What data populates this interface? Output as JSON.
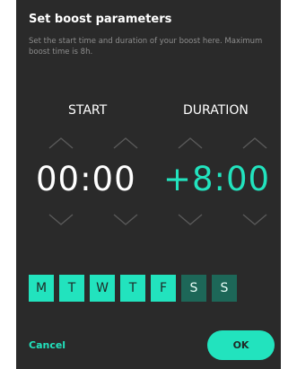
{
  "dialog": {
    "title": "Set boost parameters",
    "description": "Set the start time and duration of your boost here. Maximum boost time is 8h."
  },
  "start": {
    "label": "START",
    "value": "00:00",
    "color": "#ffffff"
  },
  "duration": {
    "label": "DURATION",
    "value": "+8:00",
    "color": "#22e3be"
  },
  "icons": {
    "up": "chevron-up-icon",
    "down": "chevron-down-icon"
  },
  "days": [
    {
      "label": "M",
      "selected": true
    },
    {
      "label": "T",
      "selected": true
    },
    {
      "label": "W",
      "selected": true
    },
    {
      "label": "T",
      "selected": true
    },
    {
      "label": "F",
      "selected": true
    },
    {
      "label": "S",
      "selected": false
    },
    {
      "label": "S",
      "selected": false
    }
  ],
  "actions": {
    "cancel": "Cancel",
    "ok": "OK"
  },
  "colors": {
    "panel": "#2a2a2a",
    "accent": "#22e3be",
    "day_off": "#1d6758",
    "muted_text": "#8d8d8d",
    "arrow": "#5a5a5a"
  }
}
